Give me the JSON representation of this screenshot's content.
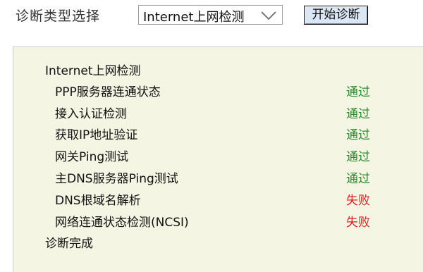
{
  "header": {
    "diag_type_label": "诊断类型选择",
    "diag_type_value": "Internet上网检测",
    "start_button": "开始诊断"
  },
  "panel": {
    "title": "Internet上网检测",
    "items": [
      {
        "name": "PPP服务器连通状态",
        "status": "通过",
        "status_color": "#2e8b2e"
      },
      {
        "name": "接入认证检测",
        "status": "通过",
        "status_color": "#2e8b2e"
      },
      {
        "name": "获取IP地址验证",
        "status": "通过",
        "status_color": "#2e8b2e"
      },
      {
        "name": "网关Ping测试",
        "status": "通过",
        "status_color": "#2e8b2e"
      },
      {
        "name": "主DNS服务器Ping测试",
        "status": "通过",
        "status_color": "#2e8b2e"
      },
      {
        "name": "DNS根域名解析",
        "status": "失败",
        "status_color": "#d42020"
      },
      {
        "name": "网络连通状态检测(NCSI)",
        "status": "失败",
        "status_color": "#d42020"
      }
    ],
    "footer": "诊断完成"
  },
  "colors": {
    "panel_bg": "#f5f5e4",
    "button_bg": "#dbe7f5",
    "pass": "#2e8b2e",
    "fail": "#d42020"
  },
  "icons": {
    "dropdown": "chevron-down-icon"
  }
}
